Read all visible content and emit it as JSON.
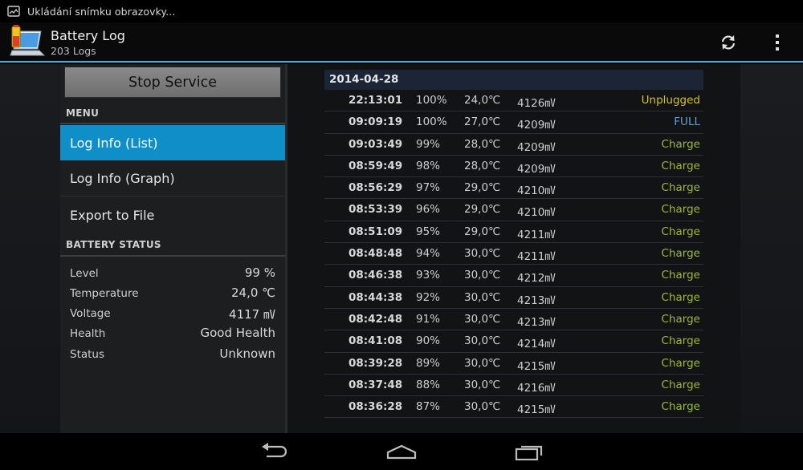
{
  "statusbar": {
    "notification_text": "Ukládání snímku obrazovky...",
    "notification_icon": "screenshot-icon"
  },
  "app": {
    "title": "Battery Log",
    "subtitle": "203 Logs",
    "icon": "battery-laptop-icon"
  },
  "actions": {
    "refresh_icon": "refresh-icon",
    "overflow_icon": "overflow-menu-icon"
  },
  "sidebar": {
    "stop_service_label": "Stop Service",
    "menu_header": "MENU",
    "menu_items": [
      {
        "label": "Log Info (List)",
        "active": true
      },
      {
        "label": "Log Info (Graph)",
        "active": false
      },
      {
        "label": "Export to File",
        "active": false
      }
    ],
    "battery_status_header": "BATTERY STATUS",
    "battery_status": [
      {
        "key": "Level",
        "value": "99 %"
      },
      {
        "key": "Temperature",
        "value": "24,0 ℃"
      },
      {
        "key": "Voltage",
        "value": "4117 ㎷"
      },
      {
        "key": "Health",
        "value": "Good Health"
      },
      {
        "key": "Status",
        "value": "Unknown"
      }
    ]
  },
  "log": {
    "date": "2014-04-28",
    "rows": [
      {
        "time": "22:13:01",
        "level": "100%",
        "temp": "24,0℃",
        "voltage": "4126㎷",
        "status": "Unplugged",
        "status_color": "#d6c21e"
      },
      {
        "time": "09:09:19",
        "level": "100%",
        "temp": "27,0℃",
        "voltage": "4209㎷",
        "status": "FULL",
        "status_color": "#5f9bd6"
      },
      {
        "time": "09:03:49",
        "level": "99%",
        "temp": "28,0℃",
        "voltage": "4209㎷",
        "status": "Charge",
        "status_color": "#9bba2e"
      },
      {
        "time": "08:59:49",
        "level": "98%",
        "temp": "28,0℃",
        "voltage": "4209㎷",
        "status": "Charge",
        "status_color": "#9bba2e"
      },
      {
        "time": "08:56:29",
        "level": "97%",
        "temp": "29,0℃",
        "voltage": "4210㎷",
        "status": "Charge",
        "status_color": "#9bba2e"
      },
      {
        "time": "08:53:39",
        "level": "96%",
        "temp": "29,0℃",
        "voltage": "4210㎷",
        "status": "Charge",
        "status_color": "#9bba2e"
      },
      {
        "time": "08:51:09",
        "level": "95%",
        "temp": "29,0℃",
        "voltage": "4211㎷",
        "status": "Charge",
        "status_color": "#9bba2e"
      },
      {
        "time": "08:48:48",
        "level": "94%",
        "temp": "30,0℃",
        "voltage": "4211㎷",
        "status": "Charge",
        "status_color": "#9bba2e"
      },
      {
        "time": "08:46:38",
        "level": "93%",
        "temp": "30,0℃",
        "voltage": "4212㎷",
        "status": "Charge",
        "status_color": "#9bba2e"
      },
      {
        "time": "08:44:38",
        "level": "92%",
        "temp": "30,0℃",
        "voltage": "4213㎷",
        "status": "Charge",
        "status_color": "#9bba2e"
      },
      {
        "time": "08:42:48",
        "level": "91%",
        "temp": "30,0℃",
        "voltage": "4213㎷",
        "status": "Charge",
        "status_color": "#9bba2e"
      },
      {
        "time": "08:41:08",
        "level": "90%",
        "temp": "30,0℃",
        "voltage": "4214㎷",
        "status": "Charge",
        "status_color": "#9bba2e"
      },
      {
        "time": "08:39:28",
        "level": "89%",
        "temp": "30,0℃",
        "voltage": "4215㎷",
        "status": "Charge",
        "status_color": "#9bba2e"
      },
      {
        "time": "08:37:48",
        "level": "88%",
        "temp": "30,0℃",
        "voltage": "4216㎷",
        "status": "Charge",
        "status_color": "#9bba2e"
      },
      {
        "time": "08:36:28",
        "level": "87%",
        "temp": "30,0℃",
        "voltage": "4215㎷",
        "status": "Charge",
        "status_color": "#9bba2e"
      }
    ]
  },
  "navbar": {
    "back_icon": "back-icon",
    "home_icon": "home-icon",
    "recents_icon": "recents-icon"
  },
  "colors": {
    "accent": "#33b5e5",
    "active_item": "#0f8ec8"
  }
}
